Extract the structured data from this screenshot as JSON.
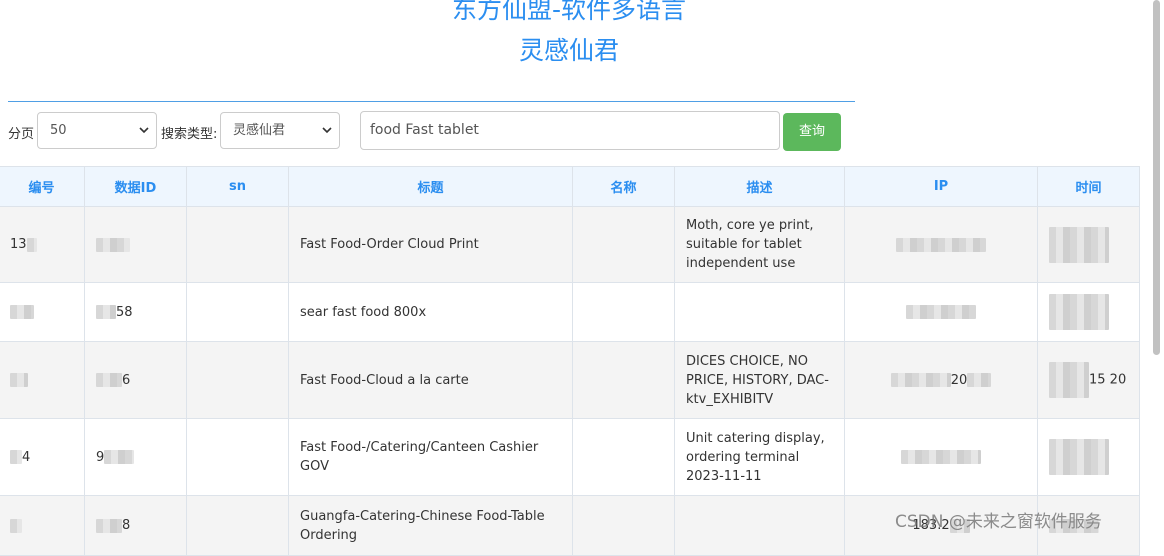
{
  "header": {
    "title_line1": "东方仙盟-软件多语言",
    "title_line2": "灵感仙君"
  },
  "toolbar": {
    "page_label": "分页",
    "page_size_value": "50",
    "search_type_label": "搜索类型:",
    "search_type_value": "灵感仙君",
    "search_value": "food  Fast tablet",
    "query_button_label": "查询"
  },
  "table": {
    "columns": [
      "编号",
      "数据ID",
      "sn",
      "标题",
      "名称",
      "描述",
      "IP",
      "时间"
    ],
    "rows": [
      {
        "id": "13",
        "data_id": "",
        "sn": "",
        "title": "Fast Food-Order Cloud Print",
        "name": "",
        "desc": "Moth, core ye print, suitable for tablet independent use",
        "ip": "",
        "time": ""
      },
      {
        "id": "",
        "data_id": "58",
        "sn": "",
        "title": "sear fast food 800x",
        "name": "",
        "desc": "",
        "ip": "",
        "time": ""
      },
      {
        "id": "",
        "data_id": "6",
        "sn": "",
        "title": "Fast Food-Cloud a la carte",
        "name": "",
        "desc": "DICES CHOICE, NO PRICE, HISTORY, DAC-ktv_EXHIBITV",
        "ip": "20",
        "time": "15 20"
      },
      {
        "id": "4",
        "data_id": "9",
        "sn": "",
        "title": "Fast Food-/Catering/Canteen Cashier GOV",
        "name": "",
        "desc": "Unit catering display, ordering terminal 2023-11-11",
        "ip": "",
        "time": ""
      },
      {
        "id": "",
        "data_id": "8",
        "sn": "",
        "title": "Guangfa-Catering-Chinese Food-Table Ordering",
        "name": "",
        "desc": "",
        "ip": "183.2",
        "time": ""
      }
    ]
  },
  "watermark": "CSDN @未来之窗软件服务"
}
